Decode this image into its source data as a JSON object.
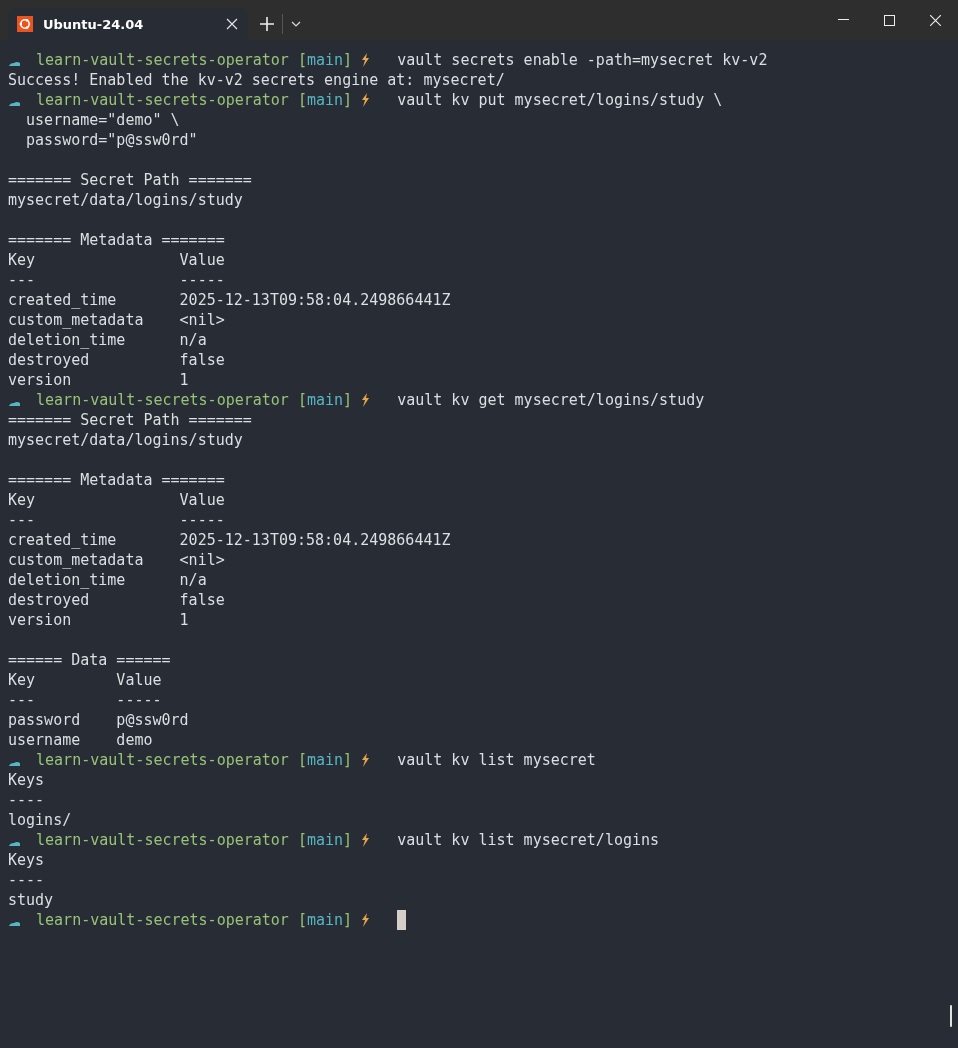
{
  "tab": {
    "title": "Ubuntu-24.04",
    "selected": true
  },
  "terminal": {
    "lines": [
      {
        "kind": "prompt",
        "dir": "learn-vault-secrets-operator",
        "branch": "[main]",
        "command": "vault secrets enable -path=mysecret kv-v2"
      },
      {
        "kind": "output",
        "text": "Success! Enabled the kv-v2 secrets engine at: mysecret/"
      },
      {
        "kind": "prompt",
        "dir": "learn-vault-secrets-operator",
        "branch": "[main]",
        "command": "vault kv put mysecret/logins/study \\"
      },
      {
        "kind": "output",
        "text": "  username=\"demo\" \\"
      },
      {
        "kind": "output",
        "text": "  password=\"p@ssw0rd\""
      },
      {
        "kind": "blank"
      },
      {
        "kind": "output",
        "text": "======= Secret Path ======="
      },
      {
        "kind": "output",
        "text": "mysecret/data/logins/study"
      },
      {
        "kind": "blank"
      },
      {
        "kind": "output",
        "text": "======= Metadata ======="
      },
      {
        "kind": "output",
        "text": "Key                Value"
      },
      {
        "kind": "output",
        "text": "---                -----"
      },
      {
        "kind": "output",
        "text": "created_time       2025-12-13T09:58:04.249866441Z"
      },
      {
        "kind": "output",
        "text": "custom_metadata    <nil>"
      },
      {
        "kind": "output",
        "text": "deletion_time      n/a"
      },
      {
        "kind": "output",
        "text": "destroyed          false"
      },
      {
        "kind": "output",
        "text": "version            1"
      },
      {
        "kind": "prompt",
        "dir": "learn-vault-secrets-operator",
        "branch": "[main]",
        "command": "vault kv get mysecret/logins/study"
      },
      {
        "kind": "output",
        "text": "======= Secret Path ======="
      },
      {
        "kind": "output",
        "text": "mysecret/data/logins/study"
      },
      {
        "kind": "blank"
      },
      {
        "kind": "output",
        "text": "======= Metadata ======="
      },
      {
        "kind": "output",
        "text": "Key                Value"
      },
      {
        "kind": "output",
        "text": "---                -----"
      },
      {
        "kind": "output",
        "text": "created_time       2025-12-13T09:58:04.249866441Z"
      },
      {
        "kind": "output",
        "text": "custom_metadata    <nil>"
      },
      {
        "kind": "output",
        "text": "deletion_time      n/a"
      },
      {
        "kind": "output",
        "text": "destroyed          false"
      },
      {
        "kind": "output",
        "text": "version            1"
      },
      {
        "kind": "blank"
      },
      {
        "kind": "output",
        "text": "====== Data ======"
      },
      {
        "kind": "output",
        "text": "Key         Value"
      },
      {
        "kind": "output",
        "text": "---         -----"
      },
      {
        "kind": "output",
        "text": "password    p@ssw0rd"
      },
      {
        "kind": "output",
        "text": "username    demo"
      },
      {
        "kind": "prompt",
        "dir": "learn-vault-secrets-operator",
        "branch": "[main]",
        "command": "vault kv list mysecret"
      },
      {
        "kind": "output",
        "text": "Keys"
      },
      {
        "kind": "output",
        "text": "----"
      },
      {
        "kind": "output",
        "text": "logins/"
      },
      {
        "kind": "prompt",
        "dir": "learn-vault-secrets-operator",
        "branch": "[main]",
        "command": "vault kv list mysecret/logins"
      },
      {
        "kind": "output",
        "text": "Keys"
      },
      {
        "kind": "output",
        "text": "----"
      },
      {
        "kind": "output",
        "text": "study"
      },
      {
        "kind": "prompt",
        "dir": "learn-vault-secrets-operator",
        "branch": "[main]",
        "cursor": true
      }
    ]
  }
}
